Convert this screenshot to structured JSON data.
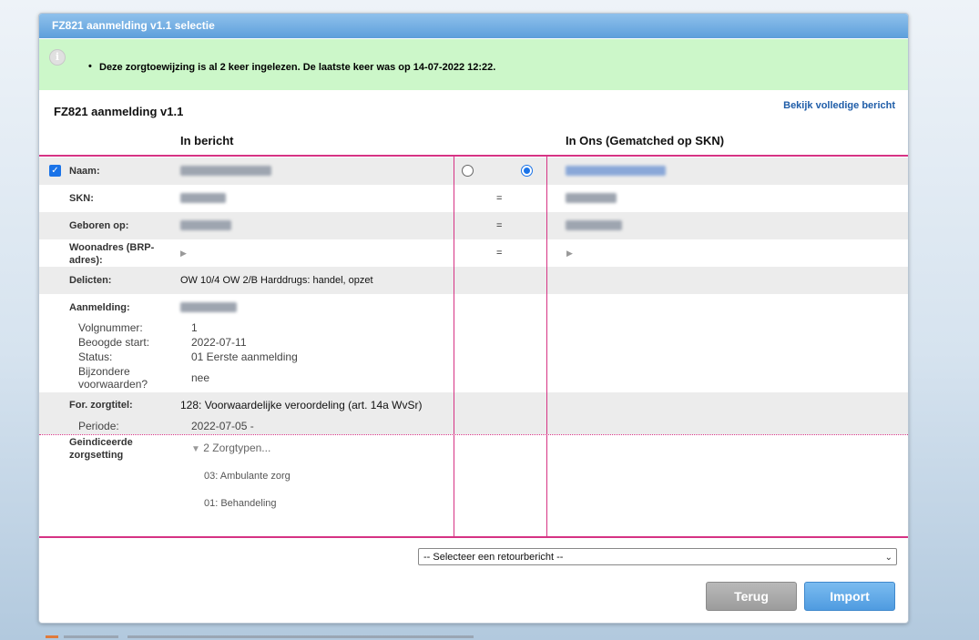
{
  "dialog": {
    "title": "FZ821 aanmelding v1.1 selectie",
    "notice": "Deze zorgtoewijzing is al 2 keer ingelezen. De laatste keer was op 14-07-2022 12:22.",
    "section_title": "FZ821 aanmelding v1.1",
    "full_message_link": "Bekijk volledige bericht",
    "columns": {
      "left": "In bericht",
      "right": "In Ons (Gematched op SKN)"
    }
  },
  "fields": {
    "naam": {
      "label": "Naam:"
    },
    "skn": {
      "label": "SKN:",
      "compare": "="
    },
    "geboren": {
      "label": "Geboren op:",
      "compare": "="
    },
    "woonadres": {
      "label": "Woonadres (BRP-adres):",
      "compare": "="
    },
    "delicten": {
      "label": "Delicten:",
      "value": "OW 10/4 OW 2/B Harddrugs: handel, opzet"
    },
    "aanmelding": {
      "label": "Aanmelding:",
      "volgnummer_label": "Volgnummer:",
      "volgnummer": "1",
      "start_label": "Beoogde start:",
      "start": "2022-07-11",
      "status_label": "Status:",
      "status": "01 Eerste aanmelding",
      "bijzondere_label": "Bijzondere voorwaarden?",
      "bijzondere": "nee"
    },
    "zorgtitel": {
      "label": "For. zorgtitel:",
      "value": "128: Voorwaardelijke veroordeling (art. 14a WvSr)",
      "periode_label": "Periode:",
      "periode": "2022-07-05 -"
    },
    "zorgsetting": {
      "label": "Geindiceerde zorgsetting",
      "toggle": "2 Zorgtypen...",
      "types": [
        "03: Ambulante zorg",
        "01: Behandeling"
      ]
    }
  },
  "actions": {
    "retour_select": "-- Selecteer een retourbericht --",
    "back": "Terug",
    "import": "Import"
  },
  "colors": {
    "accent": "#d63384",
    "notice_bg": "#ccf7c9",
    "primary": "#4f9be0"
  }
}
